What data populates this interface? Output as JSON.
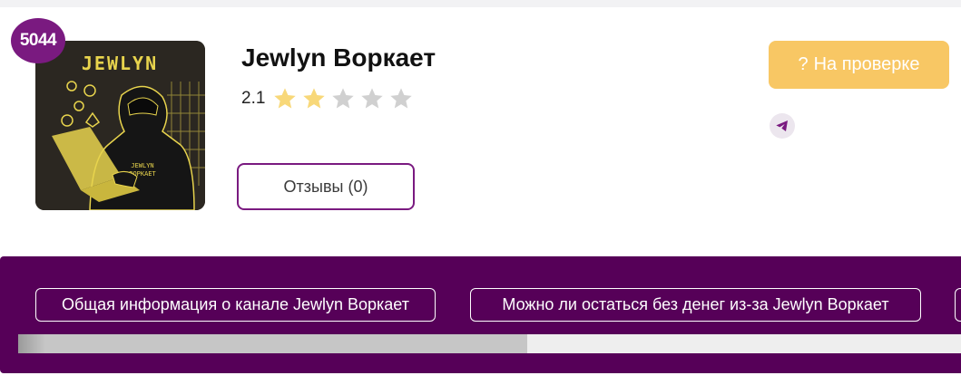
{
  "channel": {
    "rank": "5044",
    "title": "Jewlyn Воркает",
    "rating": "2.1",
    "rating_fraction": 0.42,
    "stars": [
      {
        "state": "full"
      },
      {
        "state": "full"
      },
      {
        "state": "empty"
      },
      {
        "state": "empty"
      },
      {
        "state": "empty"
      }
    ],
    "avatar": {
      "logo_text": "JEWLYN",
      "hoodie_text_1": "JEWLYN",
      "hoodie_text_2": "ВОРКАЕТ"
    }
  },
  "actions": {
    "reviews_label": "Отзывы (0)",
    "status_icon": "?",
    "status_label": "На проверке",
    "telegram_icon": "telegram-icon"
  },
  "nav": {
    "chips": [
      {
        "label": "Общая информация о канале Jewlyn Воркает"
      },
      {
        "label": "Можно ли остаться без денег из-за Jewlyn Воркает"
      },
      {
        "label": ""
      }
    ],
    "scroll_fraction": 0.54
  },
  "colors": {
    "accent": "#7a1a80",
    "nav_band": "#560058",
    "status": "#f8c764",
    "star_filled": "#f8d879",
    "star_empty": "#d0d0d0",
    "avatar_bg": "#2b2721",
    "avatar_accent": "#e8d44d"
  }
}
